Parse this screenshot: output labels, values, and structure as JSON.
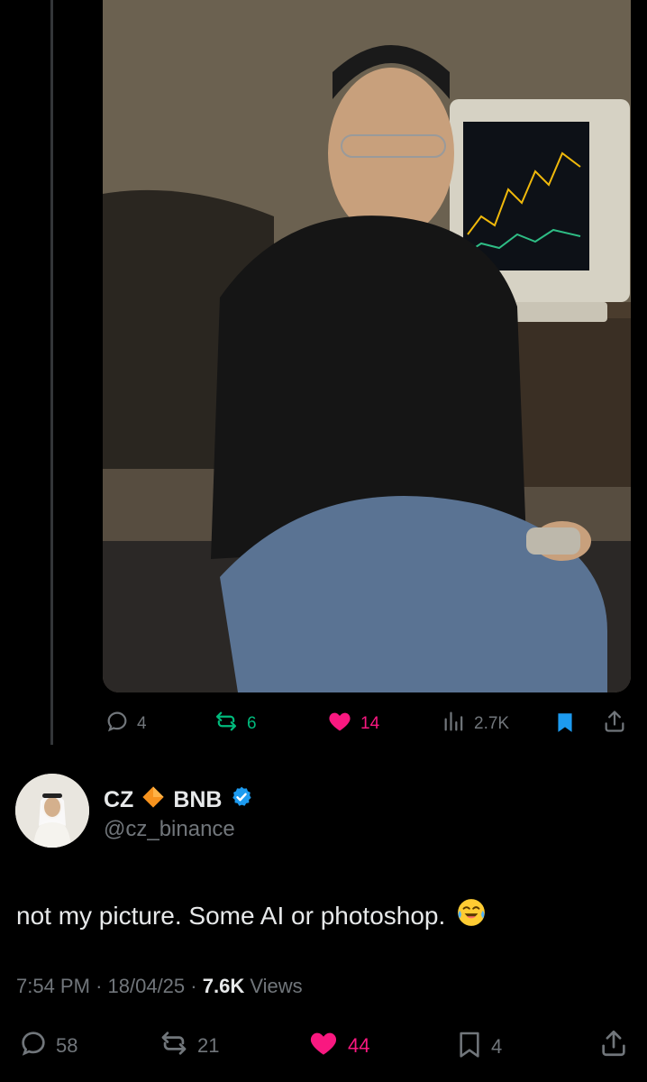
{
  "parent_tweet": {
    "photo_alt": "",
    "actions": {
      "replies": "4",
      "reposts": "6",
      "likes": "14",
      "views": "2.7K"
    },
    "colors": {
      "repost": "#00ba7c",
      "like": "#f91880",
      "bookmark": "#1d9bf0"
    }
  },
  "tweet": {
    "display_name_first": "CZ",
    "display_name_second": "BNB",
    "name_emoji": "diamond-emoji",
    "verified_icon": "verified-badge-icon",
    "handle": "@cz_binance",
    "text": "not my picture. Some AI or photoshop.",
    "text_emoji": "laughing-tears-emoji",
    "time": "7:54 PM",
    "date": "18/04/25",
    "views_count": "7.6K",
    "views_label": "Views",
    "separator": "·",
    "actions": {
      "replies": "58",
      "reposts": "21",
      "likes": "44",
      "bookmarks": "4"
    }
  }
}
